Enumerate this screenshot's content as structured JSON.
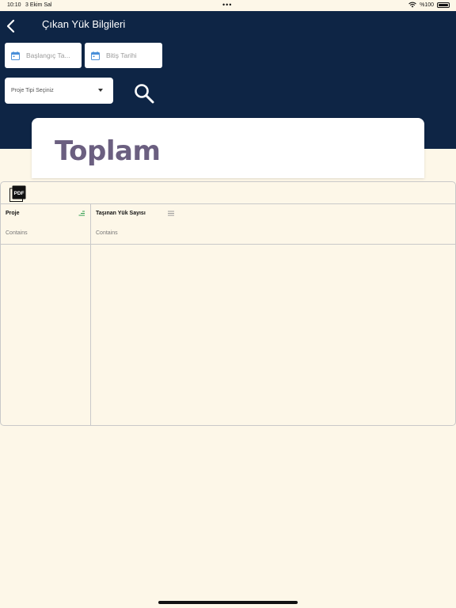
{
  "status_bar": {
    "time": "10:10",
    "date": "3 Ekim Sal",
    "dots": "•••",
    "battery": "%100",
    "icons": [
      "wifi-icon",
      "battery-icon"
    ]
  },
  "header": {
    "title": "Çıkan Yük Bilgileri",
    "back_icon": "chevron-left-icon"
  },
  "filters": {
    "start_date_placeholder": "Başlangıç Ta...",
    "end_date_placeholder": "Bitiş Tarihi",
    "date_icon": "calendar-icon",
    "project_type_placeholder": "Proje Tipi Seçiniz",
    "search_icon": "search-icon"
  },
  "summary": {
    "total_label": "Toplam"
  },
  "grid": {
    "toolbar_icon": "pdf-icon",
    "columns": [
      {
        "title": "Proje",
        "filter_placeholder": "Contains",
        "menu_icon": "sort-icon"
      },
      {
        "title": "Taşınan Yük Sayısı",
        "filter_placeholder": "Contains",
        "menu_icon": "menu-icon"
      }
    ],
    "rows": []
  },
  "colors": {
    "header_bg": "#0e2545",
    "page_bg": "#fdf7e8",
    "total_text": "#6b5f80",
    "calendar_icon": "#4a90d9",
    "sort_icon": "#2e9e4f"
  }
}
